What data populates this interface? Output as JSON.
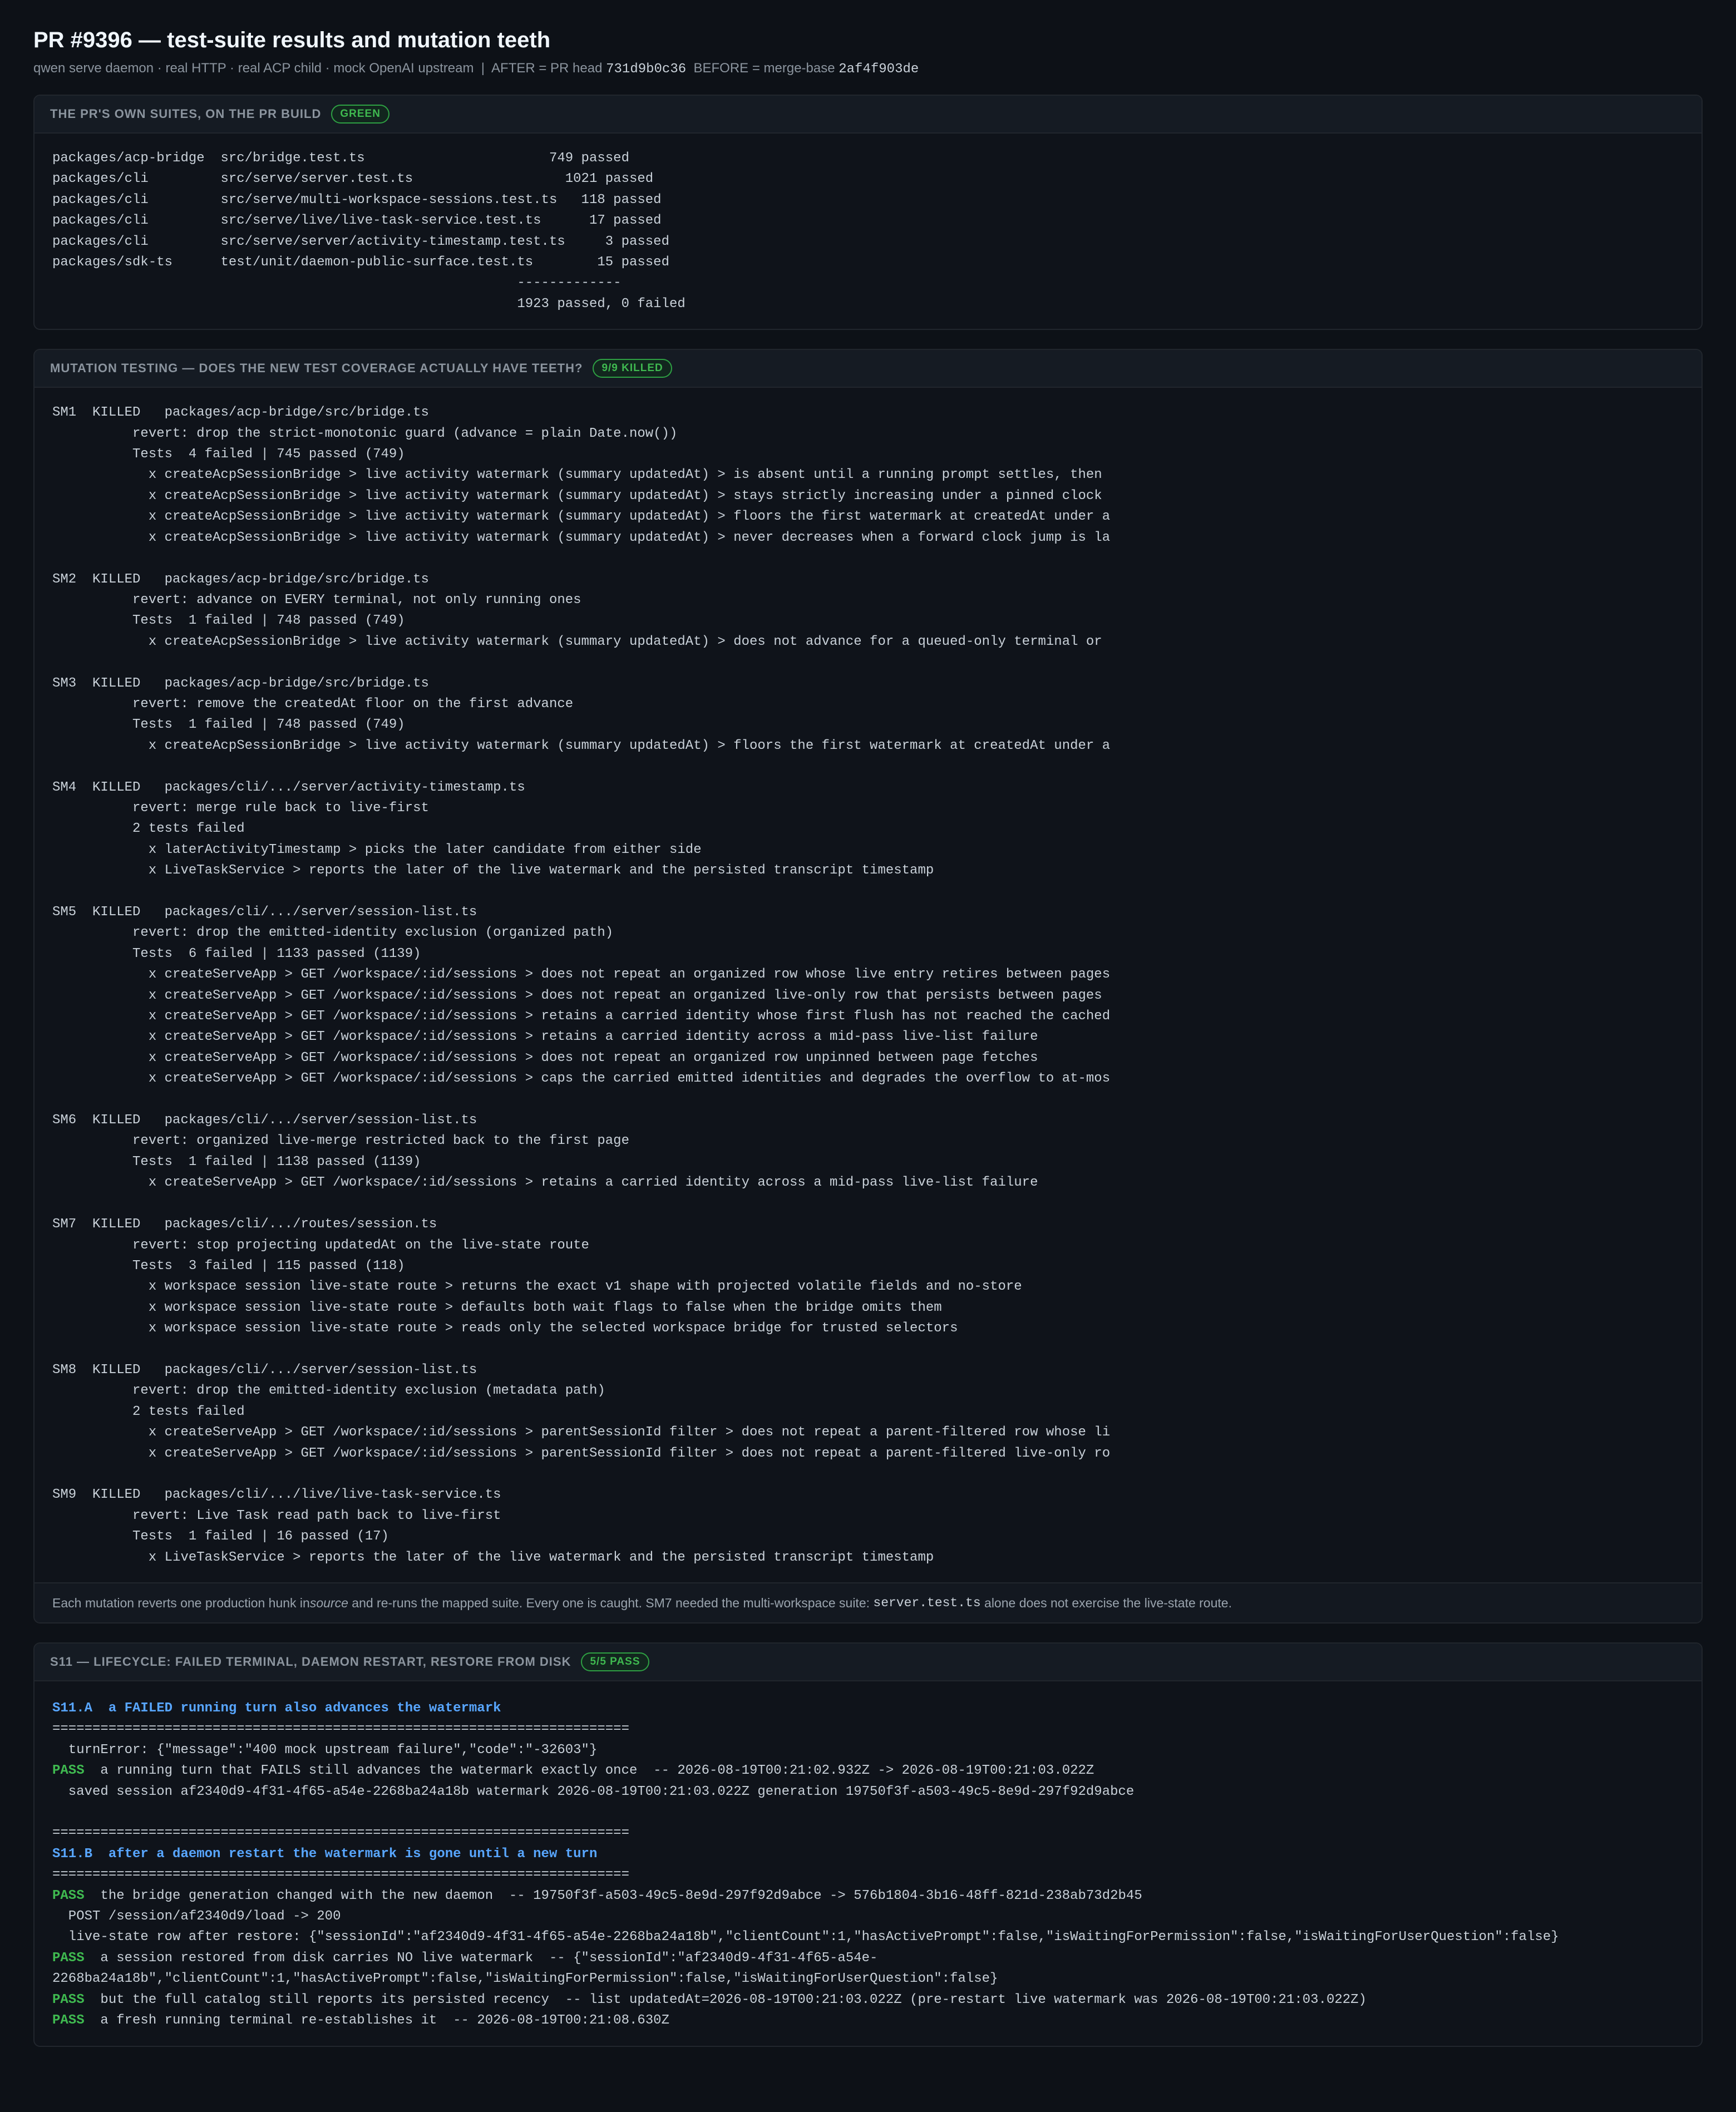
{
  "header": {
    "title": "PR #9396 — test-suite results and mutation teeth",
    "subtitle_prefix": "qwen serve daemon · real HTTP · real ACP child · mock OpenAI upstream  |  AFTER = PR head ",
    "after_sha": "731d9b0c36",
    "subtitle_mid": "  BEFORE = merge-base ",
    "before_sha": "2af4f903de"
  },
  "suites": {
    "title": "THE PR'S OWN SUITES, ON THE PR BUILD",
    "badge": "GREEN",
    "rows": [
      "packages/acp-bridge  src/bridge.test.ts                       749 passed",
      "packages/cli         src/serve/server.test.ts                   1021 passed",
      "packages/cli         src/serve/multi-workspace-sessions.test.ts   118 passed",
      "packages/cli         src/serve/live/live-task-service.test.ts      17 passed",
      "packages/cli         src/serve/server/activity-timestamp.test.ts     3 passed",
      "packages/sdk-ts      test/unit/daemon-public-surface.test.ts        15 passed",
      "                                                          -------------",
      "                                                          1923 passed, 0 failed"
    ]
  },
  "mutation": {
    "title": "MUTATION TESTING — DOES THE NEW TEST COVERAGE ACTUALLY HAVE TEETH?",
    "badge": "9/9 KILLED",
    "lines": [
      "SM1  KILLED   packages/acp-bridge/src/bridge.ts",
      "          revert: drop the strict-monotonic guard (advance = plain Date.now())",
      "          Tests  4 failed | 745 passed (749)",
      "            x createAcpSessionBridge > live activity watermark (summary updatedAt) > is absent until a running prompt settles, then",
      "            x createAcpSessionBridge > live activity watermark (summary updatedAt) > stays strictly increasing under a pinned clock",
      "            x createAcpSessionBridge > live activity watermark (summary updatedAt) > floors the first watermark at createdAt under a",
      "            x createAcpSessionBridge > live activity watermark (summary updatedAt) > never decreases when a forward clock jump is la",
      "",
      "SM2  KILLED   packages/acp-bridge/src/bridge.ts",
      "          revert: advance on EVERY terminal, not only running ones",
      "          Tests  1 failed | 748 passed (749)",
      "            x createAcpSessionBridge > live activity watermark (summary updatedAt) > does not advance for a queued-only terminal or",
      "",
      "SM3  KILLED   packages/acp-bridge/src/bridge.ts",
      "          revert: remove the createdAt floor on the first advance",
      "          Tests  1 failed | 748 passed (749)",
      "            x createAcpSessionBridge > live activity watermark (summary updatedAt) > floors the first watermark at createdAt under a",
      "",
      "SM4  KILLED   packages/cli/.../server/activity-timestamp.ts",
      "          revert: merge rule back to live-first",
      "          2 tests failed",
      "            x laterActivityTimestamp > picks the later candidate from either side",
      "            x LiveTaskService > reports the later of the live watermark and the persisted transcript timestamp",
      "",
      "SM5  KILLED   packages/cli/.../server/session-list.ts",
      "          revert: drop the emitted-identity exclusion (organized path)",
      "          Tests  6 failed | 1133 passed (1139)",
      "            x createServeApp > GET /workspace/:id/sessions > does not repeat an organized row whose live entry retires between pages",
      "            x createServeApp > GET /workspace/:id/sessions > does not repeat an organized live-only row that persists between pages",
      "            x createServeApp > GET /workspace/:id/sessions > retains a carried identity whose first flush has not reached the cached",
      "            x createServeApp > GET /workspace/:id/sessions > retains a carried identity across a mid-pass live-list failure",
      "            x createServeApp > GET /workspace/:id/sessions > does not repeat an organized row unpinned between page fetches",
      "            x createServeApp > GET /workspace/:id/sessions > caps the carried emitted identities and degrades the overflow to at-mos",
      "",
      "SM6  KILLED   packages/cli/.../server/session-list.ts",
      "          revert: organized live-merge restricted back to the first page",
      "          Tests  1 failed | 1138 passed (1139)",
      "            x createServeApp > GET /workspace/:id/sessions > retains a carried identity across a mid-pass live-list failure",
      "",
      "SM7  KILLED   packages/cli/.../routes/session.ts",
      "          revert: stop projecting updatedAt on the live-state route",
      "          Tests  3 failed | 115 passed (118)",
      "            x workspace session live-state route > returns the exact v1 shape with projected volatile fields and no-store",
      "            x workspace session live-state route > defaults both wait flags to false when the bridge omits them",
      "            x workspace session live-state route > reads only the selected workspace bridge for trusted selectors",
      "",
      "SM8  KILLED   packages/cli/.../server/session-list.ts",
      "          revert: drop the emitted-identity exclusion (metadata path)",
      "          2 tests failed",
      "            x createServeApp > GET /workspace/:id/sessions > parentSessionId filter > does not repeat a parent-filtered row whose li",
      "            x createServeApp > GET /workspace/:id/sessions > parentSessionId filter > does not repeat a parent-filtered live-only ro",
      "",
      "SM9  KILLED   packages/cli/.../live/live-task-service.ts",
      "          revert: Live Task read path back to live-first",
      "          Tests  1 failed | 16 passed (17)",
      "            x LiveTaskService > reports the later of the live watermark and the persisted transcript timestamp"
    ],
    "note_a": "Each mutation reverts one production hunk in ",
    "note_source": "source",
    "note_b": " and re-runs the mapped suite. Every one is caught. SM7 needed the multi-workspace suite: ",
    "note_code": "server.test.ts",
    "note_c": " alone does not exercise the live-state route."
  },
  "lifecycle": {
    "title": "S11 — LIFECYCLE: FAILED TERMINAL, DAEMON RESTART, RESTORE FROM DISK",
    "badge": "5/5 PASS",
    "lines": [
      {
        "kind": "hdr",
        "text": "S11.A  a FAILED running turn also advances the watermark"
      },
      {
        "kind": "plain",
        "text": "========================================================================"
      },
      {
        "kind": "plain",
        "text": "  turnError: {\"message\":\"400 mock upstream failure\",\"code\":\"-32603\"}"
      },
      {
        "kind": "pass",
        "tag": "PASS",
        "text": "  a running turn that FAILS still advances the watermark exactly once  -- 2026-08-19T00:21:02.932Z -> 2026-08-19T00:21:03.022Z"
      },
      {
        "kind": "plain",
        "text": "  saved session af2340d9-4f31-4f65-a54e-2268ba24a18b watermark 2026-08-19T00:21:03.022Z generation 19750f3f-a503-49c5-8e9d-297f92d9abce"
      },
      {
        "kind": "plain",
        "text": ""
      },
      {
        "kind": "plain",
        "text": "========================================================================"
      },
      {
        "kind": "hdr",
        "text": "S11.B  after a daemon restart the watermark is gone until a new turn"
      },
      {
        "kind": "plain",
        "text": "========================================================================"
      },
      {
        "kind": "pass",
        "tag": "PASS",
        "text": "  the bridge generation changed with the new daemon  -- 19750f3f-a503-49c5-8e9d-297f92d9abce -> 576b1804-3b16-48ff-821d-238ab73d2b45"
      },
      {
        "kind": "plain",
        "text": "  POST /session/af2340d9/load -> 200"
      },
      {
        "kind": "plain",
        "text": "  live-state row after restore: {\"sessionId\":\"af2340d9-4f31-4f65-a54e-2268ba24a18b\",\"clientCount\":1,\"hasActivePrompt\":false,\"isWaitingForPermission\":false,\"isWaitingForUserQuestion\":false}"
      },
      {
        "kind": "pass",
        "tag": "PASS",
        "text": "  a session restored from disk carries NO live watermark  -- {\"sessionId\":\"af2340d9-4f31-4f65-a54e-"
      },
      {
        "kind": "plain",
        "text": "2268ba24a18b\",\"clientCount\":1,\"hasActivePrompt\":false,\"isWaitingForPermission\":false,\"isWaitingForUserQuestion\":false}"
      },
      {
        "kind": "pass",
        "tag": "PASS",
        "text": "  but the full catalog still reports its persisted recency  -- list updatedAt=2026-08-19T00:21:03.022Z (pre-restart live watermark was 2026-08-19T00:21:03.022Z)"
      },
      {
        "kind": "pass",
        "tag": "PASS",
        "text": "  a fresh running terminal re-establishes it  -- 2026-08-19T00:21:08.630Z"
      }
    ]
  }
}
